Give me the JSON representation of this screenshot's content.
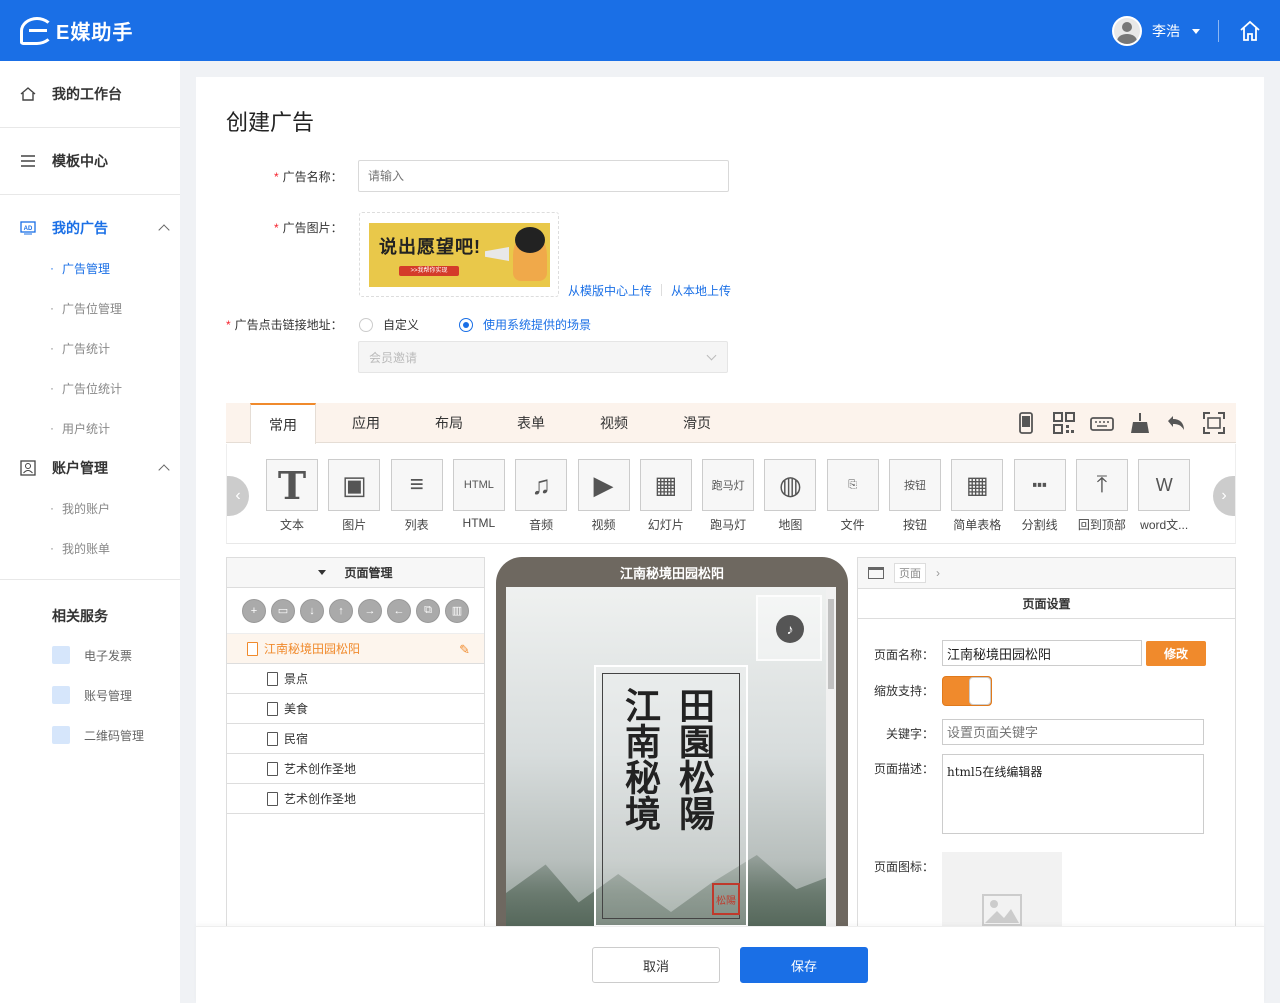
{
  "app": {
    "name": "E媒助手",
    "user": "李浩"
  },
  "sidebar": {
    "workbench": "我的工作台",
    "templates": "模板中心",
    "my_ads": "我的广告",
    "ad_items": [
      "广告管理",
      "广告位管理",
      "广告统计",
      "广告位统计",
      "用户统计"
    ],
    "account": "账户管理",
    "account_items": [
      "我的账户",
      "我的账单"
    ],
    "services_title": "相关服务",
    "services": [
      "电子发票",
      "账号管理",
      "二维码管理"
    ]
  },
  "form": {
    "title": "创建广告",
    "name_label": "广告名称：",
    "name_placeholder": "请输入",
    "image_label": "广告图片：",
    "banner_text": "说出愿望吧!",
    "banner_btn": ">>我帮你实现",
    "upload_template": "从模版中心上传",
    "upload_local": "从本地上传",
    "link_label": "广告点击链接地址：",
    "radio_custom": "自定义",
    "radio_system": "使用系统提供的场景",
    "scene_value": "会员邀请"
  },
  "editor": {
    "tabs": [
      "常用",
      "应用",
      "布局",
      "表单",
      "视频",
      "滑页"
    ],
    "tools": [
      "文本",
      "图片",
      "列表",
      "HTML",
      "音频",
      "视频",
      "幻灯片",
      "跑马灯",
      "地图",
      "文件",
      "按钮",
      "简单表格",
      "分割线",
      "回到顶部",
      "word文..."
    ],
    "tool_glyphs": [
      "T",
      "▣",
      "≡",
      "HTML",
      "♫",
      "▶",
      "▦",
      "跑马灯",
      "◍",
      "⎘",
      "按钮",
      "▦",
      "┅",
      "⤒",
      "W"
    ],
    "page_mgr_title": "页面管理",
    "pages_root": "江南秘境田园松阳",
    "pages": [
      "景点",
      "美食",
      "民宿",
      "艺术创作圣地",
      "艺术创作圣地"
    ],
    "phone_title": "江南秘境田园松阳",
    "calligraphy_col1": "田園松陽",
    "calligraphy_col2": "江南秘境",
    "seal_text": "松陽"
  },
  "settings": {
    "crumb": "页面",
    "title": "页面设置",
    "name_label": "页面名称：",
    "name_value": "江南秘境田园松阳",
    "modify_btn": "修改",
    "zoom_label": "缩放支持：",
    "keyword_label": "关键字：",
    "keyword_placeholder": "设置页面关键字",
    "desc_label": "页面描述：",
    "desc_value": "html5在线编辑器",
    "icon_label": "页面图标："
  },
  "footer": {
    "cancel": "取消",
    "save": "保存"
  }
}
